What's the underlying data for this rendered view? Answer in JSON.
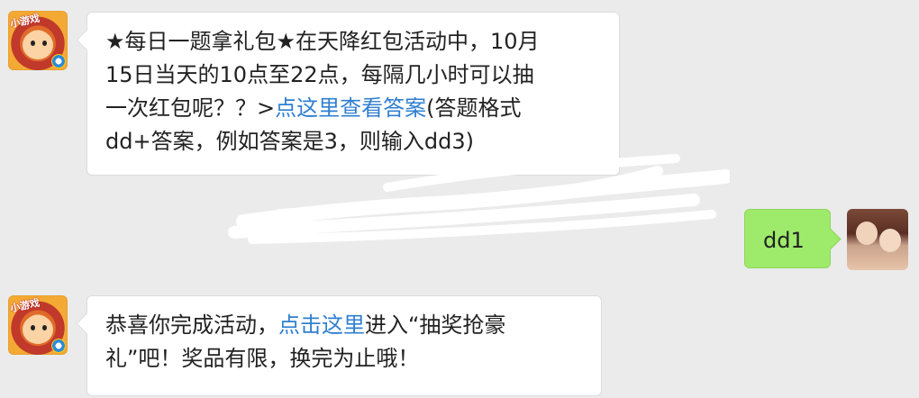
{
  "messages": [
    {
      "avatar_label": "小游戏",
      "line1": "★每日一题拿礼包★在天降红包活动中，10月",
      "line2": "15日当天的10点至22点，每隔几小时可以抽",
      "line3_prefix": "一次红包呢？？>",
      "line3_link": "点这里查看答案",
      "line3_suffix": "(答题格式",
      "line4": "dd+答案，例如答案是3，则输入dd3)"
    },
    {
      "reply": "dd1"
    },
    {
      "avatar_label": "小游戏",
      "line1_prefix": "恭喜你完成活动，",
      "line1_link": "点击这里",
      "line1_suffix": "进入“抽奖抢豪",
      "line2": "礼”吧！奖品有限，换完为止哦！"
    }
  ],
  "colors": {
    "background": "#ebebeb",
    "link": "#2f7fd1",
    "outgoing_bubble": "#9eea6a"
  }
}
